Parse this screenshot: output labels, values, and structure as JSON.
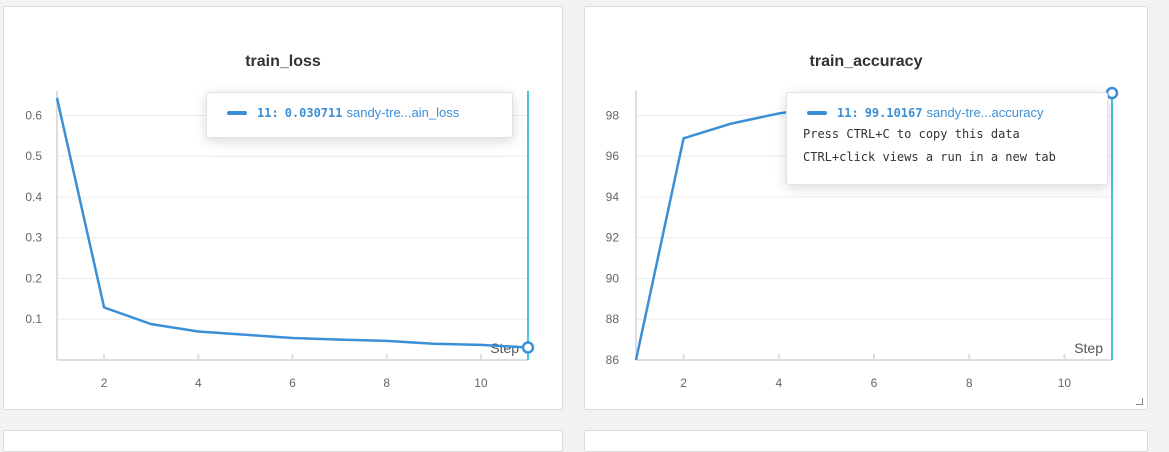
{
  "colors": {
    "line": "#3b8fd6",
    "cursor": "#41c6d8",
    "grid": "#ececec",
    "axis": "#dddddd"
  },
  "panels": [
    {
      "title": "train_loss",
      "step_label": "Step",
      "tooltip": {
        "step": "11:",
        "value": "0.030711",
        "run": "sandy-tre...ain_loss",
        "help": []
      }
    },
    {
      "title": "train_accuracy",
      "step_label": "Step",
      "tooltip": {
        "step": "11:",
        "value": "99.10167",
        "run": "sandy-tre...accuracy",
        "help": [
          "Press CTRL+C to copy this data",
          "CTRL+click views a run in a new tab"
        ]
      }
    }
  ],
  "chart_data": [
    {
      "type": "line",
      "title": "train_loss",
      "xlabel": "Step",
      "ylabel": "",
      "x": [
        1,
        2,
        3,
        4,
        5,
        6,
        7,
        8,
        9,
        10,
        11
      ],
      "series": [
        {
          "values": [
            0.643,
            0.129,
            0.088,
            0.07,
            0.062,
            0.054,
            0.05,
            0.047,
            0.04,
            0.037,
            0.0307
          ]
        }
      ],
      "xlim": [
        1,
        11
      ],
      "ylim": [
        0,
        0.66
      ],
      "xticks": [
        2,
        4,
        6,
        8,
        10
      ],
      "yticks": [
        0.1,
        0.2,
        0.3,
        0.4,
        0.5,
        0.6
      ],
      "ytick_labels": [
        "0.1",
        "0.2",
        "0.3",
        "0.4",
        "0.5",
        "0.6"
      ],
      "hover_step": 11,
      "grid": true
    },
    {
      "type": "line",
      "title": "train_accuracy",
      "xlabel": "Step",
      "ylabel": "",
      "x": [
        1,
        2,
        3,
        4,
        5,
        6,
        7,
        8,
        9,
        10,
        11
      ],
      "series": [
        {
          "values": [
            86.0,
            96.88,
            97.6,
            98.1,
            98.4,
            98.6,
            98.75,
            98.85,
            98.95,
            99.03,
            99.1
          ]
        }
      ],
      "xlim": [
        1,
        11
      ],
      "ylim": [
        86,
        99.2
      ],
      "xticks": [
        2,
        4,
        6,
        8,
        10
      ],
      "yticks": [
        86,
        88,
        90,
        92,
        94,
        96,
        98
      ],
      "ytick_labels": [
        "86",
        "88",
        "90",
        "92",
        "94",
        "96",
        "98"
      ],
      "hover_step": 11,
      "grid": true
    }
  ]
}
